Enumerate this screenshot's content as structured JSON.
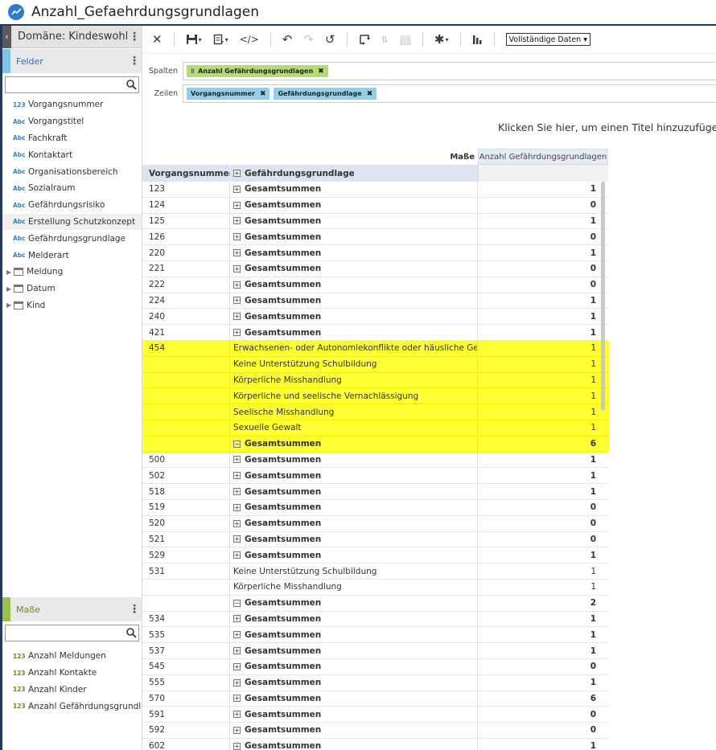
{
  "app": {
    "title": "Anzahl_Gefaehrdungsgrundlagen"
  },
  "sidebar": {
    "domain_label": "Domäne: Kindeswohl...",
    "fields_section": "Felder",
    "fields": [
      {
        "type": "123",
        "label": "Vorgangsnummer"
      },
      {
        "type": "Abc",
        "label": "Vorgangstitel"
      },
      {
        "type": "Abc",
        "label": "Fachkraft"
      },
      {
        "type": "Abc",
        "label": "Kontaktart"
      },
      {
        "type": "Abc",
        "label": "Organisationsbereich"
      },
      {
        "type": "Abc",
        "label": "Sozialraum"
      },
      {
        "type": "Abc",
        "label": "Gefährdungsrisiko"
      },
      {
        "type": "Abc",
        "label": "Erstellung Schutzkonzept"
      },
      {
        "type": "Abc",
        "label": "Gefährdungsgrundlage"
      },
      {
        "type": "Abc",
        "label": "Melderart"
      }
    ],
    "folders": [
      "Meldung",
      "Datum",
      "Kind"
    ],
    "measures_section": "Maße",
    "measures": [
      {
        "type": "123",
        "label": "Anzahl Meldungen"
      },
      {
        "type": "123",
        "label": "Anzahl Kontakte"
      },
      {
        "type": "123",
        "label": "Anzahl Kinder"
      },
      {
        "type": "123",
        "label": "Anzahl Gefährdungsgrundl..."
      }
    ]
  },
  "toolbar": {
    "data_select": "Vollständige Daten"
  },
  "shelves": {
    "columns_label": "Spalten",
    "rows_label": "Zeilen",
    "column_pills": [
      "Anzahl Gefährdungsgrundlagen"
    ],
    "row_pills": [
      "Vorgangsnummer",
      "Gefährdungsgrundlage"
    ]
  },
  "report": {
    "title_placeholder": "Klicken Sie hier, um einen Titel hinzuzufügen",
    "measures_header": "Maße",
    "measure_name": "Anzahl Gefährdungsgrundlagen",
    "row_header_1": "Vorgangsnummer",
    "row_header_2": "Gefährdungsgrundlage",
    "rows": [
      {
        "id": "123",
        "label": "Gesamtsummen",
        "value": "1",
        "total": true
      },
      {
        "id": "124",
        "label": "Gesamtsummen",
        "value": "0",
        "total": true
      },
      {
        "id": "125",
        "label": "Gesamtsummen",
        "value": "1",
        "total": true
      },
      {
        "id": "126",
        "label": "Gesamtsummen",
        "value": "0",
        "total": true
      },
      {
        "id": "220",
        "label": "Gesamtsummen",
        "value": "1",
        "total": true
      },
      {
        "id": "221",
        "label": "Gesamtsummen",
        "value": "0",
        "total": true
      },
      {
        "id": "222",
        "label": "Gesamtsummen",
        "value": "0",
        "total": true
      },
      {
        "id": "224",
        "label": "Gesamtsummen",
        "value": "1",
        "total": true
      },
      {
        "id": "240",
        "label": "Gesamtsummen",
        "value": "1",
        "total": true
      },
      {
        "id": "421",
        "label": "Gesamtsummen",
        "value": "1",
        "total": true
      },
      {
        "id": "454",
        "label": "Erwachsenen- oder Autonomiekonflikte oder häusliche Gewalt",
        "value": "1",
        "total": false,
        "highlight": true
      },
      {
        "id": "",
        "label": "Keine Unterstützung Schulbildung",
        "value": "1",
        "total": false,
        "highlight": true
      },
      {
        "id": "",
        "label": "Körperliche Misshandlung",
        "value": "1",
        "total": false,
        "highlight": true
      },
      {
        "id": "",
        "label": "Körperliche und seelische Vernachlässigung",
        "value": "1",
        "total": false,
        "highlight": true
      },
      {
        "id": "",
        "label": "Seelische Misshandlung",
        "value": "1",
        "total": false,
        "highlight": true
      },
      {
        "id": "",
        "label": "Sexuelle Gewalt",
        "value": "1",
        "total": false,
        "highlight": true
      },
      {
        "id": "",
        "label": "Gesamtsummen",
        "value": "6",
        "total": true,
        "highlight": true,
        "expanded": true
      },
      {
        "id": "500",
        "label": "Gesamtsummen",
        "value": "1",
        "total": true
      },
      {
        "id": "502",
        "label": "Gesamtsummen",
        "value": "1",
        "total": true
      },
      {
        "id": "518",
        "label": "Gesamtsummen",
        "value": "1",
        "total": true
      },
      {
        "id": "519",
        "label": "Gesamtsummen",
        "value": "0",
        "total": true
      },
      {
        "id": "520",
        "label": "Gesamtsummen",
        "value": "0",
        "total": true
      },
      {
        "id": "521",
        "label": "Gesamtsummen",
        "value": "0",
        "total": true
      },
      {
        "id": "529",
        "label": "Gesamtsummen",
        "value": "1",
        "total": true
      },
      {
        "id": "531",
        "label": "Keine Unterstützung Schulbildung",
        "value": "1",
        "total": false
      },
      {
        "id": "",
        "label": "Körperliche Misshandlung",
        "value": "1",
        "total": false
      },
      {
        "id": "",
        "label": "Gesamtsummen",
        "value": "2",
        "total": true,
        "expanded": true
      },
      {
        "id": "534",
        "label": "Gesamtsummen",
        "value": "1",
        "total": true
      },
      {
        "id": "535",
        "label": "Gesamtsummen",
        "value": "1",
        "total": true
      },
      {
        "id": "537",
        "label": "Gesamtsummen",
        "value": "1",
        "total": true
      },
      {
        "id": "545",
        "label": "Gesamtsummen",
        "value": "0",
        "total": true
      },
      {
        "id": "555",
        "label": "Gesamtsummen",
        "value": "1",
        "total": true
      },
      {
        "id": "570",
        "label": "Gesamtsummen",
        "value": "6",
        "total": true
      },
      {
        "id": "591",
        "label": "Gesamtsummen",
        "value": "0",
        "total": true
      },
      {
        "id": "592",
        "label": "Gesamtsummen",
        "value": "0",
        "total": true
      },
      {
        "id": "602",
        "label": "Gesamtsummen",
        "value": "1",
        "total": true
      }
    ]
  }
}
